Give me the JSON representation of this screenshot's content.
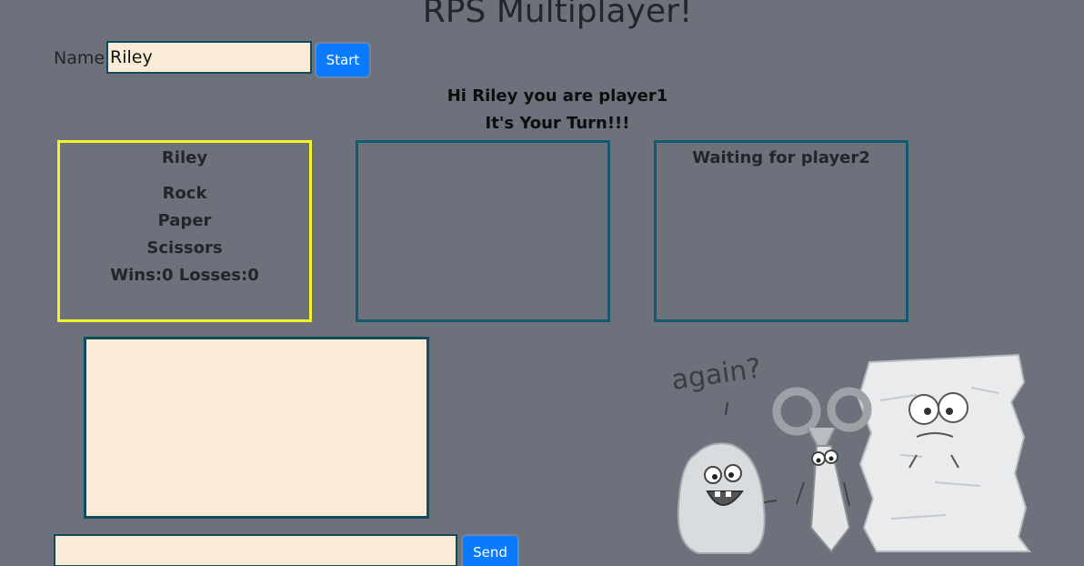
{
  "header": {
    "title": "RPS Multiplayer!"
  },
  "name_form": {
    "label": "Name",
    "value": "Riley",
    "start_label": "Start"
  },
  "status": {
    "greeting": "Hi Riley you are player1",
    "turn": "It's Your Turn!!!"
  },
  "player1": {
    "name": "Riley",
    "choices": [
      "Rock",
      "Paper",
      "Scissors"
    ],
    "score": "Wins:0 Losses:0",
    "highlight_color": "#f4f42a"
  },
  "player2": {
    "waiting": "Waiting for player2"
  },
  "chat": {
    "send_label": "Send"
  },
  "illustration": {
    "caption": "again?"
  },
  "colors": {
    "background": "#6c717b",
    "box_border": "#125a6e",
    "input_bg": "#faebd7",
    "button": "#0a7bff"
  }
}
